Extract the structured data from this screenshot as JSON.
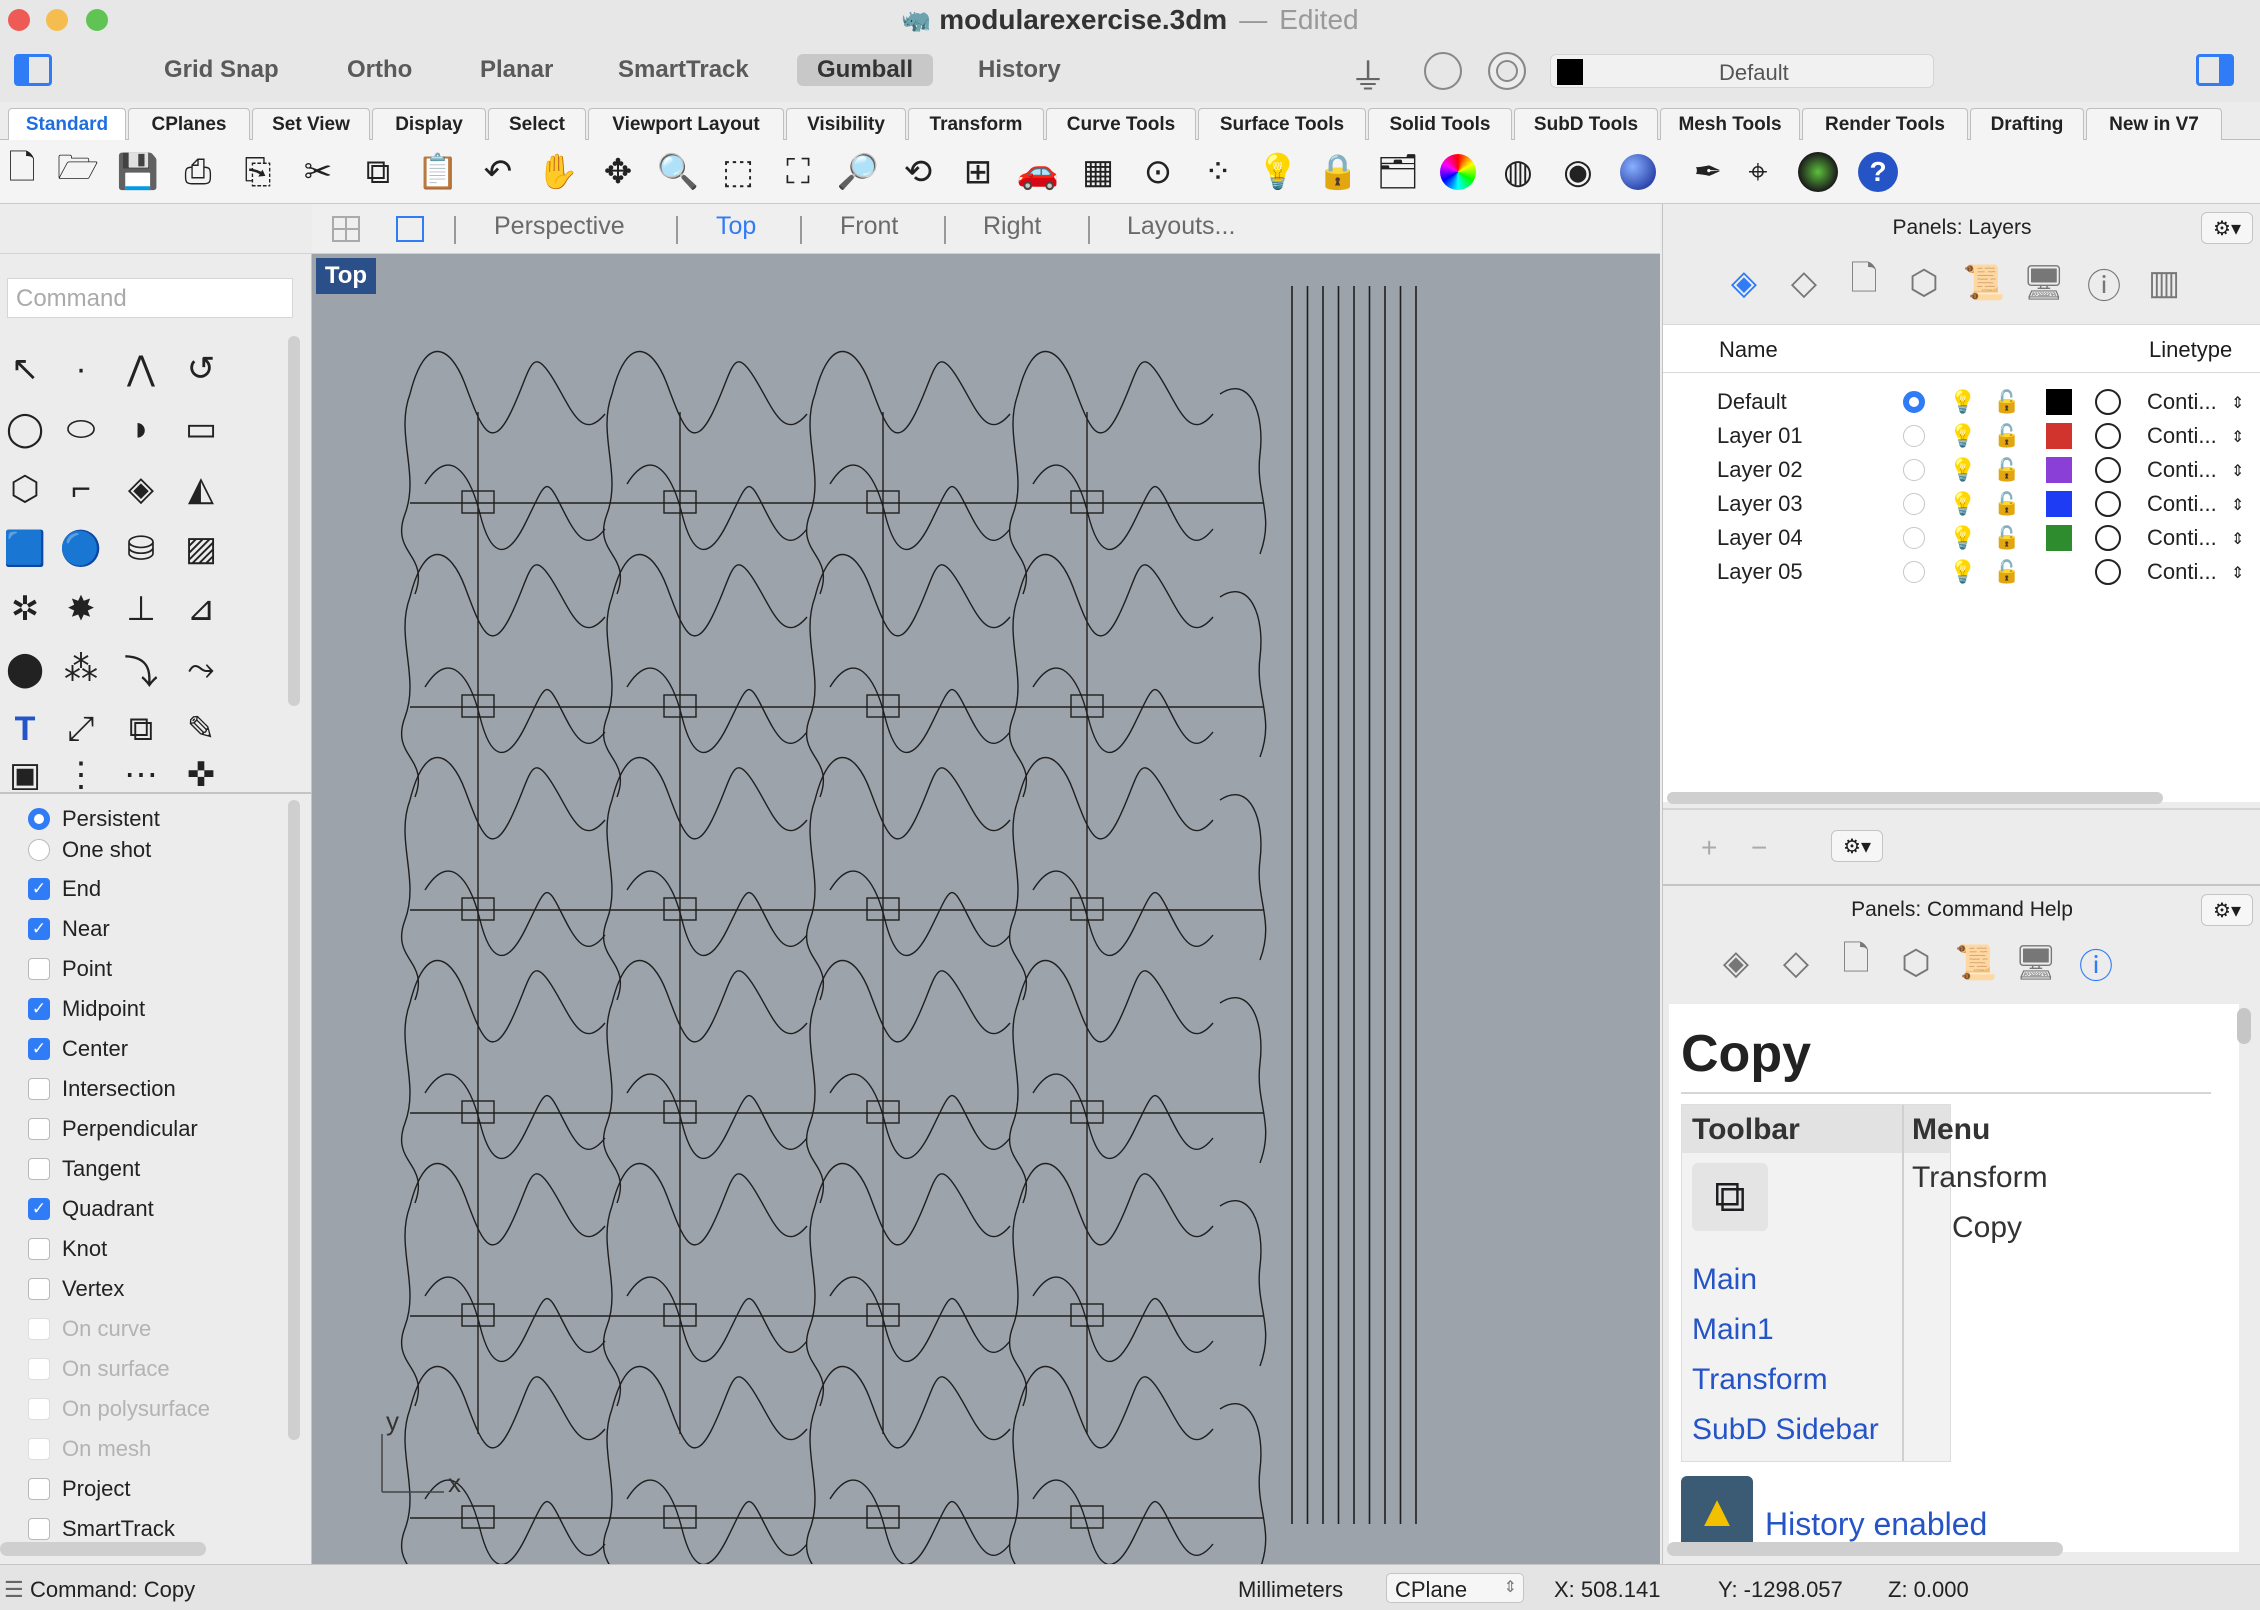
{
  "window": {
    "doc_name": "modularexercise.3dm",
    "separator": "—",
    "status": "Edited"
  },
  "topbar": {
    "buttons": [
      "Grid Snap",
      "Ortho",
      "Planar",
      "SmartTrack",
      "Gumball",
      "History"
    ],
    "active": "Gumball",
    "layer_name": "Default"
  },
  "tabs": [
    "Standard",
    "CPlanes",
    "Set View",
    "Display",
    "Select",
    "Viewport Layout",
    "Visibility",
    "Transform",
    "Curve Tools",
    "Surface Tools",
    "Solid Tools",
    "SubD Tools",
    "Mesh Tools",
    "Render Tools",
    "Drafting",
    "New in V7"
  ],
  "active_tab": "Standard",
  "left": {
    "command_placeholder": "Command",
    "osnap_mode": [
      {
        "label": "Persistent",
        "on": true
      },
      {
        "label": "One shot",
        "on": false
      }
    ],
    "osnaps": [
      {
        "label": "End",
        "on": true,
        "dim": false
      },
      {
        "label": "Near",
        "on": true,
        "dim": false
      },
      {
        "label": "Point",
        "on": false,
        "dim": false
      },
      {
        "label": "Midpoint",
        "on": true,
        "dim": false
      },
      {
        "label": "Center",
        "on": true,
        "dim": false
      },
      {
        "label": "Intersection",
        "on": false,
        "dim": false
      },
      {
        "label": "Perpendicular",
        "on": false,
        "dim": false
      },
      {
        "label": "Tangent",
        "on": false,
        "dim": false
      },
      {
        "label": "Quadrant",
        "on": true,
        "dim": false
      },
      {
        "label": "Knot",
        "on": false,
        "dim": false
      },
      {
        "label": "Vertex",
        "on": false,
        "dim": false
      },
      {
        "label": "On curve",
        "on": false,
        "dim": true
      },
      {
        "label": "On surface",
        "on": false,
        "dim": true
      },
      {
        "label": "On polysurface",
        "on": false,
        "dim": true
      },
      {
        "label": "On mesh",
        "on": false,
        "dim": true
      },
      {
        "label": "Project",
        "on": false,
        "dim": false
      },
      {
        "label": "SmartTrack",
        "on": false,
        "dim": false
      }
    ]
  },
  "viewport_tabs": [
    "Perspective",
    "Top",
    "Front",
    "Right",
    "Layouts..."
  ],
  "active_viewport": "Top",
  "viewport": {
    "label": "Top",
    "axis_y": "y",
    "axis_x": "x"
  },
  "layers_panel": {
    "title": "Panels: Layers",
    "col_name": "Name",
    "col_linetype": "Linetype",
    "layers": [
      {
        "name": "Default",
        "current": true,
        "color": "#000000",
        "linetype": "Conti..."
      },
      {
        "name": "Layer 01",
        "current": false,
        "color": "#d0342c",
        "linetype": "Conti..."
      },
      {
        "name": "Layer 02",
        "current": false,
        "color": "#8a3fd6",
        "linetype": "Conti..."
      },
      {
        "name": "Layer 03",
        "current": false,
        "color": "#1f3cf5",
        "linetype": "Conti..."
      },
      {
        "name": "Layer 04",
        "current": false,
        "color": "#2e8b2e",
        "linetype": "Conti..."
      },
      {
        "name": "Layer 05",
        "current": false,
        "color": "#ffffff",
        "linetype": "Conti..."
      }
    ]
  },
  "help_panel": {
    "title": "Panels: Command Help",
    "command": "Copy",
    "col_toolbar": "Toolbar",
    "col_menu": "Menu",
    "menu_path_1": "Transform",
    "menu_path_2": "Copy",
    "toolbars": [
      "Main",
      "Main1",
      "Transform",
      "SubD Sidebar"
    ],
    "history": "History enabled"
  },
  "status": {
    "command": "Command: Copy",
    "units": "Millimeters",
    "cplane": "CPlane",
    "x": "X: 508.141",
    "y": "Y: -1298.057",
    "z": "Z: 0.000"
  }
}
